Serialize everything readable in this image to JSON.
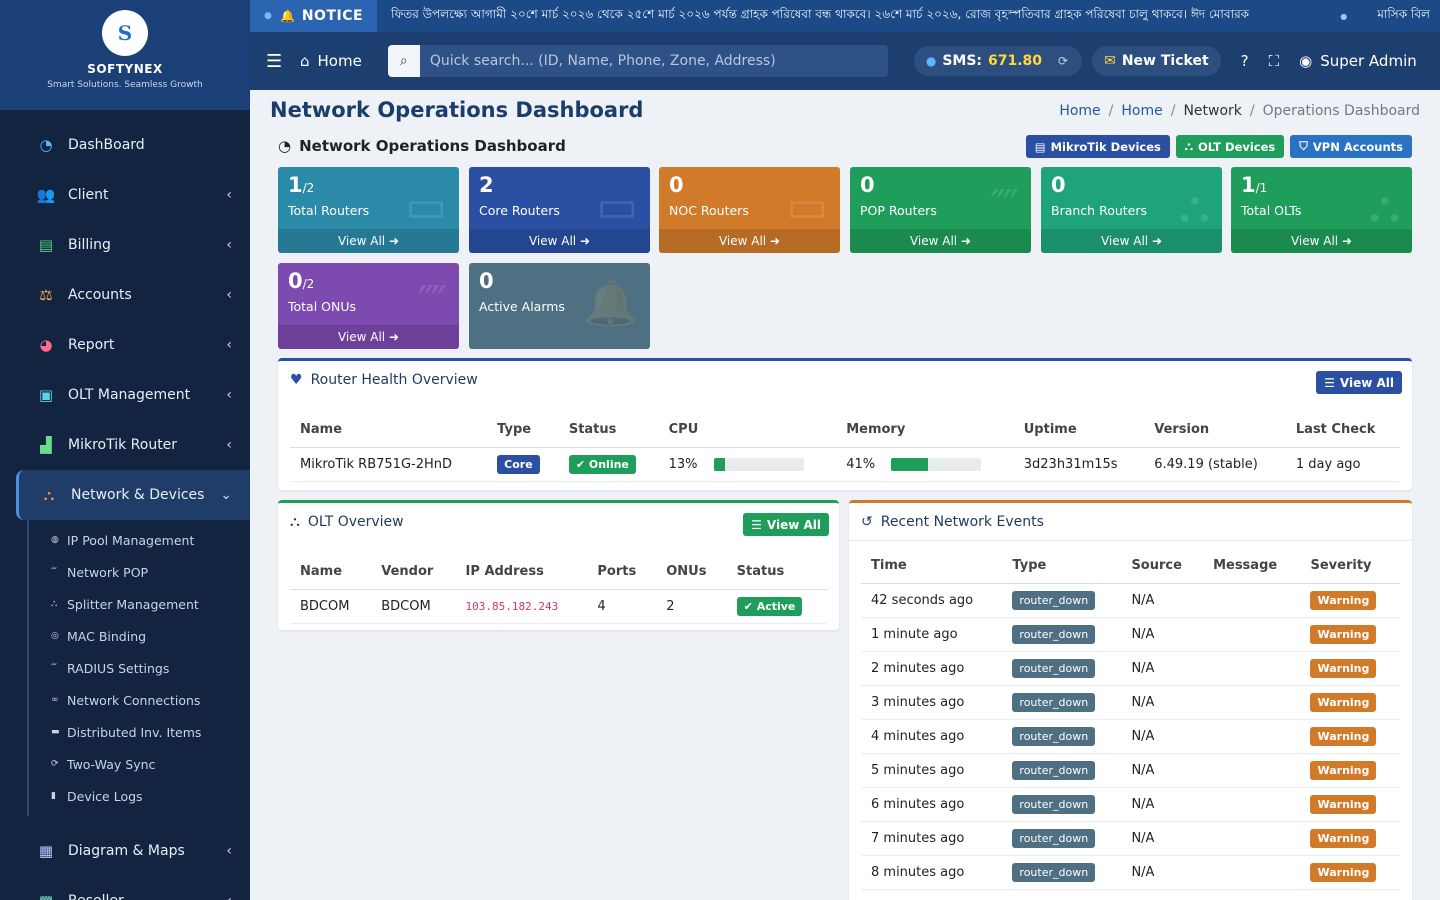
{
  "brand": {
    "logo_text": "S",
    "name": "SOFTYNEX",
    "tagline": "Smart Solutions. Seamless Growth"
  },
  "sidebar": {
    "items": [
      {
        "label": "DashBoard",
        "icon": "gauge-icon",
        "glyph": "◔",
        "color": "#5fb3ff",
        "chevron": false
      },
      {
        "label": "Client",
        "icon": "users-icon",
        "glyph": "👥",
        "color": "#c98cff",
        "chevron": true
      },
      {
        "label": "Billing",
        "icon": "bill-icon",
        "glyph": "▤",
        "color": "#57d18a",
        "chevron": true
      },
      {
        "label": "Accounts",
        "icon": "scale-icon",
        "glyph": "⚖",
        "color": "#ffb14d",
        "chevron": true
      },
      {
        "label": "Report",
        "icon": "pie-chart-icon",
        "glyph": "◕",
        "color": "#ff6b8a",
        "chevron": true
      },
      {
        "label": "OLT Management",
        "icon": "chip-icon",
        "glyph": "▣",
        "color": "#5bd6e8",
        "chevron": true
      },
      {
        "label": "MikroTik Router",
        "icon": "router-icon",
        "glyph": "▟",
        "color": "#6bdc8e",
        "chevron": true
      }
    ],
    "active": {
      "label": "Network & Devices",
      "icon": "network-icon",
      "glyph": "⛬",
      "color": "#ff9f43"
    },
    "sub_items": [
      {
        "label": "IP Pool Management",
        "icon": "globe-icon",
        "glyph": "◍"
      },
      {
        "label": "Network POP",
        "icon": "broadcast-icon",
        "glyph": "⁗"
      },
      {
        "label": "Splitter Management",
        "icon": "sitemap-icon",
        "glyph": "⛬"
      },
      {
        "label": "MAC Binding",
        "icon": "fingerprint-icon",
        "glyph": "◎"
      },
      {
        "label": "RADIUS Settings",
        "icon": "broadcast-icon",
        "glyph": "⁗"
      },
      {
        "label": "Network Connections",
        "icon": "link-icon",
        "glyph": "∞"
      },
      {
        "label": "Distributed Inv. Items",
        "icon": "truck-icon",
        "glyph": "▬"
      },
      {
        "label": "Two-Way Sync",
        "icon": "sync-icon",
        "glyph": "⟳"
      },
      {
        "label": "Device Logs",
        "icon": "trash-icon",
        "glyph": "▮"
      }
    ],
    "bottom_items": [
      {
        "label": "Diagram & Maps",
        "icon": "map-icon",
        "glyph": "▦",
        "color": "#b8c6ff"
      },
      {
        "label": "Reseller",
        "icon": "reseller-icon",
        "glyph": "▩",
        "color": "#7fd7c4"
      }
    ]
  },
  "notice": {
    "badge": "NOTICE",
    "message": "ফিতর উপলক্ষ্যে আগামী ২০শে মার্চ ২০২৬ থেকে ২৫শে মার্চ ২০২৬ পর্যন্ত গ্রাহক পরিষেবা বন্ধ থাকবে। ২৬শে মার্চ ২০২৬, রোজ বৃহস্পতিবার গ্রাহক পরিষেবা চালু থাকবে। ঈদ মোবারক",
    "message2": "মাসিক বিল"
  },
  "header": {
    "home_label": "Home",
    "search_placeholder": "Quick search... (ID, Name, Phone, Zone, Address)",
    "sms_label": "SMS:",
    "sms_value": "671.80",
    "ticket_label": "New Ticket",
    "user_label": "Super Admin"
  },
  "page": {
    "title": "Network Operations Dashboard",
    "breadcrumb": [
      "Home",
      "Home",
      "Network",
      "Operations Dashboard"
    ],
    "section_title": "Network Operations Dashboard"
  },
  "quick_buttons": [
    {
      "label": "MikroTik Devices",
      "icon": "server-icon",
      "glyph": "▤",
      "color": "#2a4fa3"
    },
    {
      "label": "OLT Devices",
      "icon": "sitemap-icon",
      "glyph": "⛬",
      "color": "#1e9e5a"
    },
    {
      "label": "VPN Accounts",
      "icon": "shield-icon",
      "glyph": "⛉",
      "color": "#2a73c4"
    }
  ],
  "stats": [
    {
      "value": "1",
      "sub": "/2",
      "label": "Total Routers",
      "footer": "View All ➜",
      "color": "#2b8aa8",
      "ghost": "▭"
    },
    {
      "value": "2",
      "sub": "",
      "label": "Core Routers",
      "footer": "View All ➜",
      "color": "#2a4fa3",
      "ghost": "▭"
    },
    {
      "value": "0",
      "sub": "",
      "label": "NOC Routers",
      "footer": "View All ➜",
      "color": "#d07a2a",
      "ghost": "▭"
    },
    {
      "value": "0",
      "sub": "",
      "label": "POP Routers",
      "footer": "View All ➜",
      "color": "#1e9e5a",
      "ghost": "⁗"
    },
    {
      "value": "0",
      "sub": "",
      "label": "Branch Routers",
      "footer": "View All ➜",
      "color": "#1fa37a",
      "ghost": "⛬"
    },
    {
      "value": "1",
      "sub": "/1",
      "label": "Total OLTs",
      "footer": "View All ➜",
      "color": "#1e9e5a",
      "ghost": "⛬"
    },
    {
      "value": "0",
      "sub": "/2",
      "label": "Total ONUs",
      "footer": "View All ➜",
      "color": "#7d4bb0",
      "ghost": "⁗"
    },
    {
      "value": "0",
      "sub": "",
      "label": "Active Alarms",
      "footer": "",
      "color": "#4f6f82",
      "ghost": "🔔"
    }
  ],
  "router_health": {
    "title": "Router Health Overview",
    "view_all": "View All",
    "columns": [
      "Name",
      "Type",
      "Status",
      "CPU",
      "Memory",
      "Uptime",
      "Version",
      "Last Check"
    ],
    "rows": [
      {
        "name": "MikroTik RB751G-2HnD",
        "type": "Core",
        "status": "Online",
        "cpu": "13%",
        "cpu_pct": 13,
        "memory": "41%",
        "mem_pct": 41,
        "uptime": "3d23h31m15s",
        "version": "6.49.19 (stable)",
        "last_check": "1 day ago"
      }
    ]
  },
  "olt_overview": {
    "title": "OLT Overview",
    "view_all": "View All",
    "columns": [
      "Name",
      "Vendor",
      "IP Address",
      "Ports",
      "ONUs",
      "Status"
    ],
    "rows": [
      {
        "name": "BDCOM",
        "vendor": "BDCOM",
        "ip": "103.85.182.243",
        "ports": "4",
        "onus": "2",
        "status": "Active"
      }
    ]
  },
  "events": {
    "title": "Recent Network Events",
    "columns": [
      "Time",
      "Type",
      "Source",
      "Message",
      "Severity"
    ],
    "rows": [
      {
        "time": "42 seconds ago",
        "type": "router_down",
        "source": "N/A",
        "message": "",
        "severity": "Warning"
      },
      {
        "time": "1 minute ago",
        "type": "router_down",
        "source": "N/A",
        "message": "",
        "severity": "Warning"
      },
      {
        "time": "2 minutes ago",
        "type": "router_down",
        "source": "N/A",
        "message": "",
        "severity": "Warning"
      },
      {
        "time": "3 minutes ago",
        "type": "router_down",
        "source": "N/A",
        "message": "",
        "severity": "Warning"
      },
      {
        "time": "4 minutes ago",
        "type": "router_down",
        "source": "N/A",
        "message": "",
        "severity": "Warning"
      },
      {
        "time": "5 minutes ago",
        "type": "router_down",
        "source": "N/A",
        "message": "",
        "severity": "Warning"
      },
      {
        "time": "6 minutes ago",
        "type": "router_down",
        "source": "N/A",
        "message": "",
        "severity": "Warning"
      },
      {
        "time": "7 minutes ago",
        "type": "router_down",
        "source": "N/A",
        "message": "",
        "severity": "Warning"
      },
      {
        "time": "8 minutes ago",
        "type": "router_down",
        "source": "N/A",
        "message": "",
        "severity": "Warning"
      }
    ]
  },
  "colors": {
    "core": "#2a4fa3",
    "online": "#1e9e5a",
    "type_pill": "#4f6f82",
    "warning": "#d07a2a",
    "olt_accent": "#1e9e5a",
    "events_accent": "#d07a2a",
    "router_accent": "#2a4fa3"
  }
}
